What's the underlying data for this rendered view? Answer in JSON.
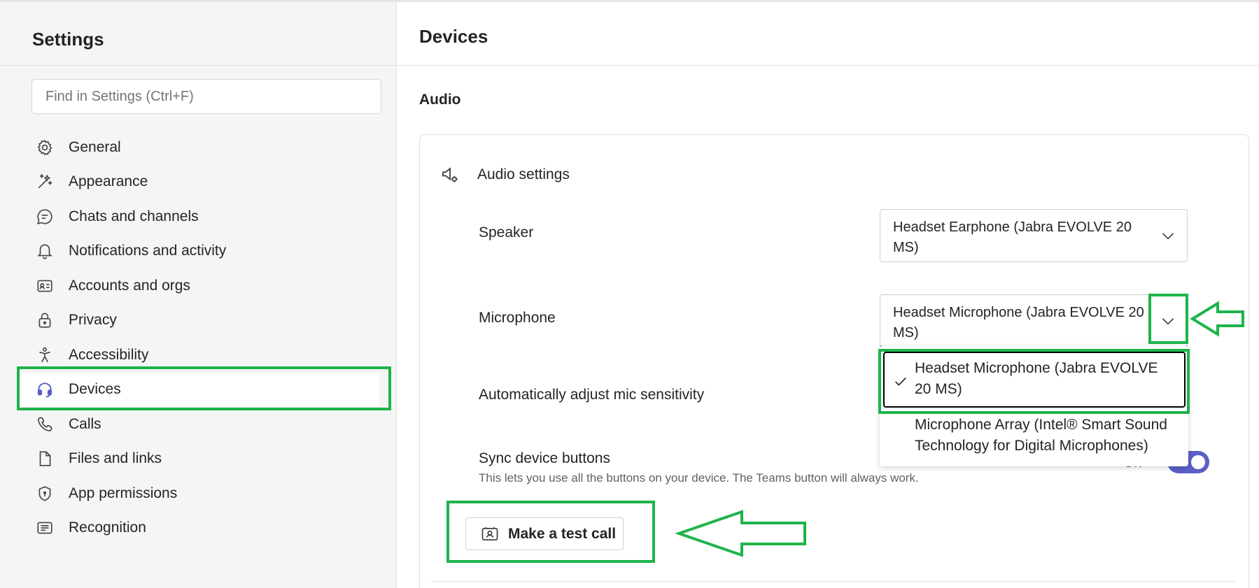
{
  "sidebar": {
    "title": "Settings",
    "search_placeholder": "Find in Settings (Ctrl+F)",
    "items": [
      {
        "label": "General",
        "icon": "gear-icon"
      },
      {
        "label": "Appearance",
        "icon": "magic-wand-icon"
      },
      {
        "label": "Chats and channels",
        "icon": "chat-bubble-icon"
      },
      {
        "label": "Notifications and activity",
        "icon": "bell-icon"
      },
      {
        "label": "Accounts and orgs",
        "icon": "contact-card-icon"
      },
      {
        "label": "Privacy",
        "icon": "lock-icon"
      },
      {
        "label": "Accessibility",
        "icon": "accessibility-icon"
      },
      {
        "label": "Devices",
        "icon": "headset-icon",
        "active": true
      },
      {
        "label": "Calls",
        "icon": "phone-icon"
      },
      {
        "label": "Files and links",
        "icon": "document-icon"
      },
      {
        "label": "App permissions",
        "icon": "shield-icon"
      },
      {
        "label": "Recognition",
        "icon": "text-box-icon"
      }
    ]
  },
  "main": {
    "title": "Devices",
    "section": "Audio",
    "card": {
      "heading": "Audio settings",
      "speaker_label": "Speaker",
      "speaker_value": "Headset Earphone (Jabra EVOLVE 20 MS)",
      "microphone_label": "Microphone",
      "microphone_value": "Headset Microphone (Jabra EVOLVE 20 MS)",
      "auto_adjust_label": "Automatically adjust mic sensitivity",
      "sync_label": "Sync device buttons",
      "sync_desc": "This lets you use all the buttons on your device. The Teams button will always work.",
      "sync_state": "On",
      "test_call_label": "Make a test call"
    },
    "mic_options": [
      {
        "label": "Headset Microphone (Jabra EVOLVE 20 MS)",
        "selected": true
      },
      {
        "label": "Microphone Array (Intel® Smart Sound Technology for Digital Microphones)",
        "selected": false
      }
    ]
  },
  "colors": {
    "accent": "#5b5fc7",
    "annotation": "#1eb44a",
    "sidebar_bg": "#f5f5f5"
  }
}
